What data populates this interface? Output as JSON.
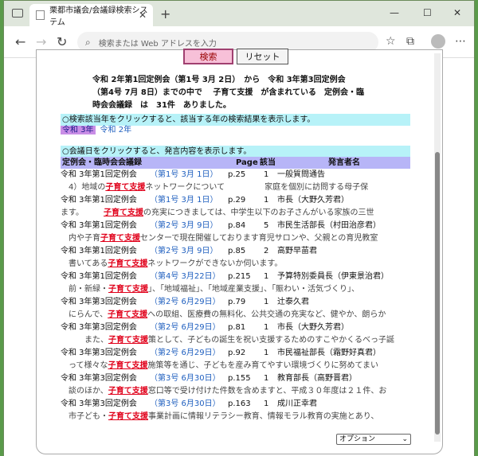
{
  "browser": {
    "tab_title": "栗都市議会/会議録検索システム",
    "address_placeholder": "検索または Web アドレスを入力"
  },
  "buttons": {
    "search": "検索",
    "reset": "リセット"
  },
  "summary": {
    "line1": "令和 2年第1回定例会（第1号 3月 2日）　から　令和 3年第3回定例会",
    "line2": "（第4号 7月 8日）までの中で　 子育て支援　が含まれている　定例会・臨",
    "line3": "時会会議録　は　31件　ありました。"
  },
  "hint_year": "○検索該当年をクリックすると、該当する年の検索結果を表示します。",
  "years": [
    "令和 3年",
    "令和 2年"
  ],
  "hint_date": "○会議日をクリックすると、発言内容を表示します。",
  "table_headers": {
    "session": "定例会・臨時会会議録",
    "page": "Page",
    "rank": "該当",
    "speaker": "発言者名"
  },
  "rows": [
    {
      "session": "令和 3年第1回定例会",
      "date": "（第1号 3月 1日）",
      "page": "p.25",
      "count": "1",
      "speaker": "一般質問通告",
      "pre": "　4）地域の",
      "kw": "子育て支援",
      "post": "ネットワークについて　　　　　家庭を個別に訪問する母子保"
    },
    {
      "session": "令和 3年第1回定例会",
      "date": "（第1号 3月 1日）",
      "page": "p.29",
      "count": "1",
      "speaker": "市長（大野久芳君）",
      "pre": "ます。　　　",
      "kw": "子育て支援",
      "post": "の充実につきましては、中学生以下のお子さんがいる家族の三世"
    },
    {
      "session": "令和 3年第1回定例会",
      "date": "（第2号 3月 9日）",
      "page": "p.84",
      "count": "5",
      "speaker": "市民生活部長（村田治彦君）",
      "pre": "　内や子育",
      "kw": "子育て支援",
      "post": "センターで現在開催しております育児サロンや、父親との育児教室"
    },
    {
      "session": "令和 3年第1回定例会",
      "date": "（第2号 3月 9日）",
      "page": "p.85",
      "count": "2",
      "speaker": "高野早苗君",
      "pre": "　書いてある",
      "kw": "子育て支援",
      "post": "ネットワークができないか伺います。"
    },
    {
      "session": "令和 3年第1回定例会",
      "date": "（第4号 3月22日）",
      "page": "p.215",
      "count": "1",
      "speaker": "予算特別委員長（伊東景治君）",
      "pre": "　前・新緑・",
      "kw": "子育て支援",
      "post": "」、「地域福祉」、「地域産業支援」、「賑わい・活気づくり」、"
    },
    {
      "session": "令和 3年第3回定例会",
      "date": "（第2号 6月29日）",
      "page": "p.79",
      "count": "1",
      "speaker": "辻泰久君",
      "pre": "　にらんで、",
      "kw": "子育て支援",
      "post": "への取組、医療費の無料化、公共交通の充実など、健やか、朗らか"
    },
    {
      "session": "令和 3年第3回定例会",
      "date": "（第2号 6月29日）",
      "page": "p.81",
      "count": "1",
      "speaker": "市長（大野久芳君）",
      "pre": "　　　また、",
      "kw": "子育て支援",
      "post": "策として、子どもの誕生を祝い支援するためのすこやかくるべっ子誕"
    },
    {
      "session": "令和 3年第3回定例会",
      "date": "（第2号 6月29日）",
      "page": "p.92",
      "count": "1",
      "speaker": "市民福祉部長（霜野好真君）",
      "pre": "　って様々な",
      "kw": "子育て支援",
      "post": "施策等を通じ、子どもを産み育てやすい環境づくりに努めてまい"
    },
    {
      "session": "令和 3年第3回定例会",
      "date": "（第3号 6月30日）",
      "page": "p.155",
      "count": "1",
      "speaker": "教育部長（高野晋君）",
      "pre": "　談のほか、",
      "kw": "子育て支援",
      "post": "窓口等で受け付けた件数を含めますと、平成３０年度は２１件、お"
    },
    {
      "session": "令和 3年第3回定例会",
      "date": "（第3号 6月30日）",
      "page": "p.163",
      "count": "1",
      "speaker": "成川正幸君",
      "pre": "　市子ども・",
      "kw": "子育て支援",
      "post": "事業計画に情報リテラシー教育、情報モラル教育の実施とあり、"
    }
  ],
  "option_select": "オプション"
}
